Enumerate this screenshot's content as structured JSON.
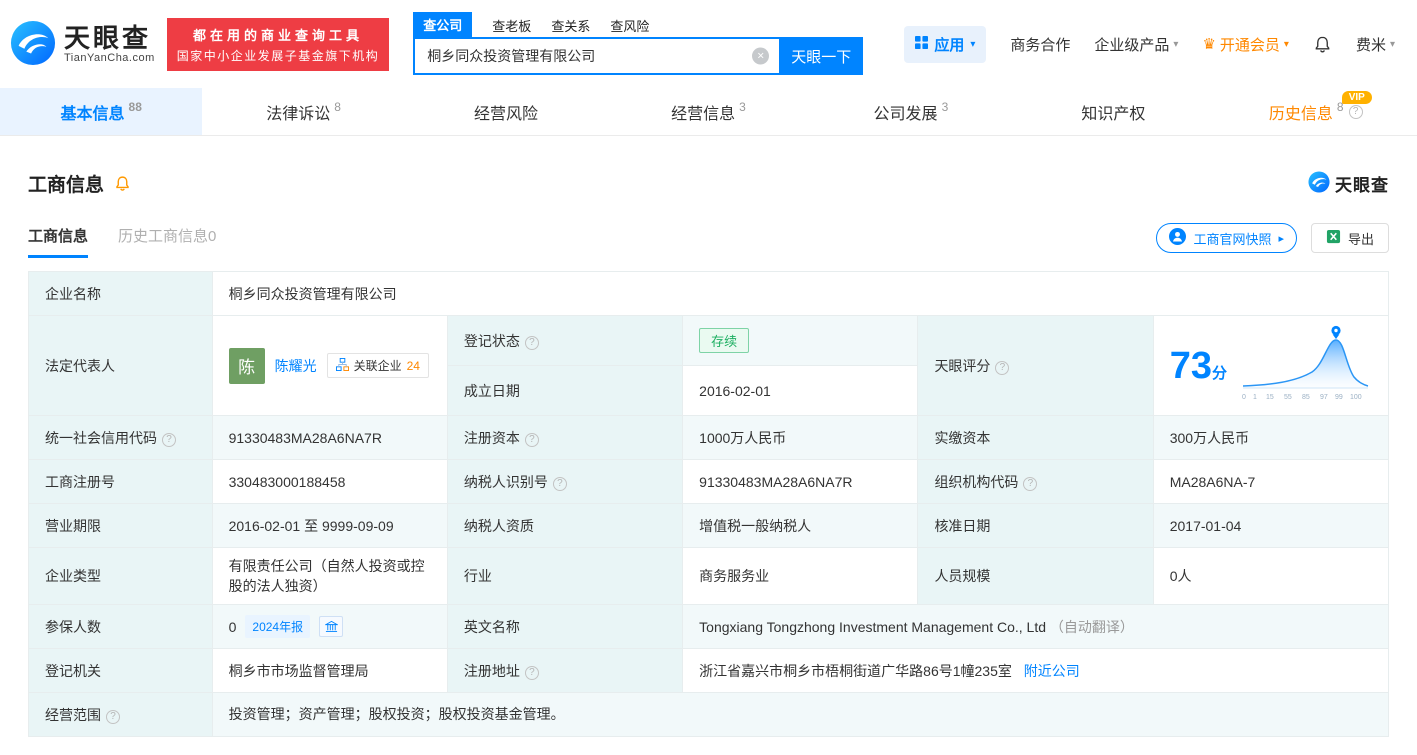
{
  "brand": {
    "logo_title": "天眼查",
    "logo_domain": "TianYanCha.com",
    "slogan_line1": "都在用的商业查询工具",
    "slogan_line2": "国家中小企业发展子基金旗下机构"
  },
  "search": {
    "tabs": [
      {
        "label": "查公司"
      },
      {
        "label": "查老板"
      },
      {
        "label": "查关系"
      },
      {
        "label": "查风险"
      }
    ],
    "value": "桐乡同众投资管理有限公司",
    "button_label": "天眼一下"
  },
  "top_nav": {
    "app_label": "应用",
    "items": [
      {
        "label": "商务合作"
      },
      {
        "label": "企业级产品"
      },
      {
        "label": "开通会员"
      },
      {
        "label": "费米"
      }
    ]
  },
  "main_tabs": [
    {
      "label": "基本信息",
      "count": "88"
    },
    {
      "label": "法律诉讼",
      "count": "8"
    },
    {
      "label": "经营风险",
      "count": ""
    },
    {
      "label": "经营信息",
      "count": "3"
    },
    {
      "label": "公司发展",
      "count": "3"
    },
    {
      "label": "知识产权",
      "count": ""
    },
    {
      "label": "历史信息",
      "count": "8",
      "vip": "VIP"
    }
  ],
  "section": {
    "title": "工商信息",
    "logo_text": "天眼查",
    "subtabs": [
      {
        "label": "工商信息"
      },
      {
        "label": "历史工商信息0"
      }
    ],
    "snapshot_label": "工商官网快照",
    "export_label": "导出"
  },
  "table": {
    "company_name_label": "企业名称",
    "company_name": "桐乡同众投资管理有限公司",
    "legal_rep_label": "法定代表人",
    "legal_rep_avatar": "陈",
    "legal_rep_name": "陈耀光",
    "related_companies_label": "关联企业",
    "related_companies_count": "24",
    "reg_status_label": "登记状态",
    "reg_status": "存续",
    "est_date_label": "成立日期",
    "est_date": "2016-02-01",
    "score_label": "天眼评分",
    "score_value": "73",
    "score_unit": "分",
    "score_ticks": [
      "0",
      "1",
      "15",
      "55",
      "85",
      "97",
      "99",
      "100"
    ],
    "uscc_label": "统一社会信用代码",
    "uscc": "91330483MA28A6NA7R",
    "reg_capital_label": "注册资本",
    "reg_capital": "1000万人民币",
    "paid_capital_label": "实缴资本",
    "paid_capital": "300万人民币",
    "reg_number_label": "工商注册号",
    "reg_number": "330483000188458",
    "taxpayer_id_label": "纳税人识别号",
    "taxpayer_id": "91330483MA28A6NA7R",
    "org_code_label": "组织机构代码",
    "org_code": "MA28A6NA-7",
    "business_term_label": "营业期限",
    "business_term": "2016-02-01 至 9999-09-09",
    "taxpayer_quality_label": "纳税人资质",
    "taxpayer_quality": "增值税一般纳税人",
    "approved_date_label": "核准日期",
    "approved_date": "2017-01-04",
    "company_type_label": "企业类型",
    "company_type": "有限责任公司（自然人投资或控股的法人独资）",
    "industry_label": "行业",
    "industry": "商务服务业",
    "staff_size_label": "人员规模",
    "staff_size": "0人",
    "insured_label": "参保人数",
    "insured_count": "0",
    "annual_report_badge": "2024年报",
    "english_name_label": "英文名称",
    "english_name": "Tongxiang Tongzhong Investment Management Co., Ltd",
    "english_name_note": "（自动翻译）",
    "reg_authority_label": "登记机关",
    "reg_authority": "桐乡市市场监督管理局",
    "address_label": "注册地址",
    "address": "浙江省嘉兴市桐乡市梧桐街道广华路86号1幢235室",
    "nearby_link": "附近公司",
    "business_scope_label": "经营范围",
    "business_scope": "投资管理；资产管理；股权投资；股权投资基金管理。"
  }
}
